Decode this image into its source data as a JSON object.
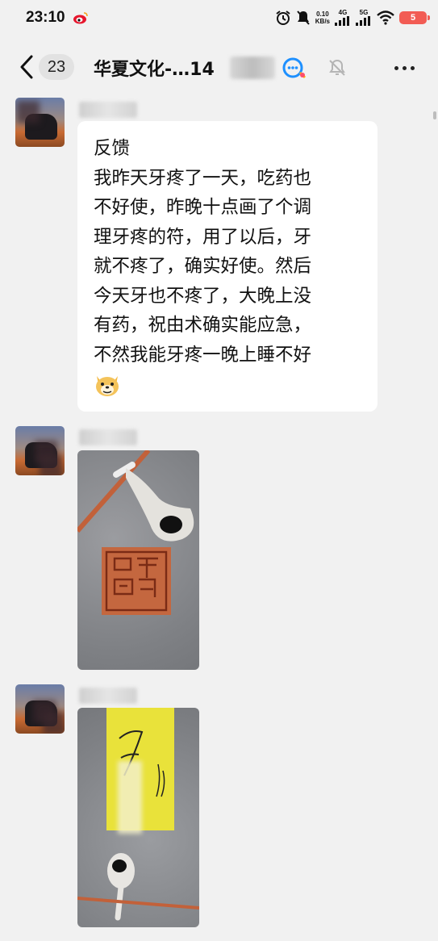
{
  "status_bar": {
    "time": "23:10",
    "net_speed_value": "0.10",
    "net_speed_unit": "KB/s",
    "signal_1_label": "4G",
    "signal_2_label": "5G",
    "battery_level": "5"
  },
  "header": {
    "unread_count": "23",
    "chat_title": "华夏文化-…14",
    "icons": [
      "back-arrow",
      "qq-chat",
      "mute-bell",
      "more-dots"
    ]
  },
  "messages": [
    {
      "type": "text",
      "lines": [
        "反馈",
        "我昨天牙疼了一天，吃药也",
        "不好使，昨晚十点画了个调",
        "理牙疼的符，用了以后，牙",
        "就不疼了，确实好使。然后",
        "今天牙也不疼了，大晚上没",
        "有药，祝由术确实能应急，",
        "不然我能牙疼一晚上睡不好"
      ],
      "emoji": "doge"
    },
    {
      "type": "image",
      "image_label": "photo-seal-and-spoon"
    },
    {
      "type": "image",
      "image_label": "photo-yellow-talisman-and-spoon"
    }
  ],
  "colors": {
    "background": "#f1f1f1",
    "bubble": "#ffffff",
    "battery": "#f25c54",
    "qq_blue": "#1e90ff"
  }
}
